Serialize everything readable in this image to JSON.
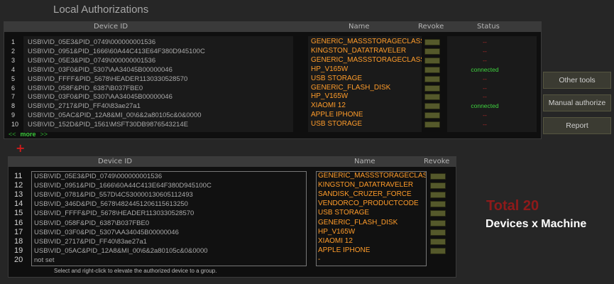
{
  "title": "Local Authorizations",
  "top_table": {
    "headers": {
      "device_id": "Device ID",
      "name": "Name",
      "revoke": "Revoke",
      "status": "Status"
    },
    "rows": [
      {
        "num": "1",
        "device_id": "USB\\VID_05E3&PID_0749\\000000001536",
        "name": "GENERIC_MASSSTORAGECLASS",
        "status": "--"
      },
      {
        "num": "2",
        "device_id": "USB\\VID_0951&PID_1666\\60A44C413E64F380D945100C",
        "name": "KINGSTON_DATATRAVELER",
        "status": "--"
      },
      {
        "num": "3",
        "device_id": "USB\\VID_05E3&PID_0749\\000000001536",
        "name": "GENERIC_MASSSTORAGECLASS",
        "status": "--"
      },
      {
        "num": "4",
        "device_id": "USB\\VID_03F0&PID_5307\\AA34045B00000046",
        "name": "HP_V165W",
        "status": "connected"
      },
      {
        "num": "5",
        "device_id": "USB\\VID_FFFF&PID_5678\\HEADER1130330528570",
        "name": "USB STORAGE",
        "status": "--"
      },
      {
        "num": "6",
        "device_id": "USB\\VID_058F&PID_6387\\B037FBE0",
        "name": "GENERIC_FLASH_DISK",
        "status": "--"
      },
      {
        "num": "7",
        "device_id": "USB\\VID_03F0&PID_5307\\AA34045B00000046",
        "name": "HP_V165W",
        "status": "--"
      },
      {
        "num": "8",
        "device_id": "USB\\VID_2717&PID_FF40\\83ae27a1",
        "name": "XIAOMI 12",
        "status": "connected"
      },
      {
        "num": "9",
        "device_id": "USB\\VID_05AC&PID_12A8&MI_00\\6&2a80105c&0&0000",
        "name": "APPLE IPHONE",
        "status": "--"
      },
      {
        "num": "10",
        "device_id": "USB\\VID_152D&PID_1561\\MSFT30DB9876543214E",
        "name": "USB STORAGE",
        "status": "--"
      }
    ],
    "more": {
      "left": "<<",
      "label": "more",
      "right": ">>"
    }
  },
  "plus_icon": "+",
  "side_buttons": {
    "other_tools": "Other tools",
    "manual_authorize": "Manual authorize",
    "report": "Report"
  },
  "bottom_table": {
    "headers": {
      "device_id": "Device ID",
      "name": "Name",
      "revoke": "Revoke"
    },
    "rows": [
      {
        "num": "11",
        "device_id": "USB\\VID_05E3&PID_0749\\000000001536",
        "name": "GENERIC_MASSSTORAGECLASS"
      },
      {
        "num": "12",
        "device_id": "USB\\VID_0951&PID_1666\\60A44C413E64F380D945100C",
        "name": "KINGSTON_DATATRAVELER"
      },
      {
        "num": "13",
        "device_id": "USB\\VID_0781&PID_557D\\4C530000130605112493",
        "name": "SANDISK_CRUZER_FORCE"
      },
      {
        "num": "14",
        "device_id": "USB\\VID_346D&PID_5678\\4824451206115613250",
        "name": "VENDORCO_PRODUCTCODE"
      },
      {
        "num": "15",
        "device_id": "USB\\VID_FFFF&PID_5678\\HEADER1130330528570",
        "name": "USB STORAGE"
      },
      {
        "num": "16",
        "device_id": "USB\\VID_058F&PID_6387\\B037FBE0",
        "name": "GENERIC_FLASH_DISK"
      },
      {
        "num": "17",
        "device_id": "USB\\VID_03F0&PID_5307\\AA34045B00000046",
        "name": "HP_V165W"
      },
      {
        "num": "18",
        "device_id": "USB\\VID_2717&PID_FF40\\83ae27a1",
        "name": "XIAOMI 12"
      },
      {
        "num": "19",
        "device_id": "USB\\VID_05AC&PID_12A8&MI_00\\6&2a80105c&0&0000",
        "name": "APPLE IPHONE"
      },
      {
        "num": "20",
        "device_id": "not set",
        "name": "-"
      }
    ],
    "hint": "Select and right-click to elevate the authorized device to a group."
  },
  "summary": {
    "total": "Total 20",
    "subtitle": "Devices x Machine"
  },
  "colors": {
    "name_orange": "#ff9c2a",
    "connected_green": "#3fd23f",
    "dash_red": "#c12a2a",
    "revoke_olive": "#55592b",
    "total_red": "#8e1a1a"
  }
}
